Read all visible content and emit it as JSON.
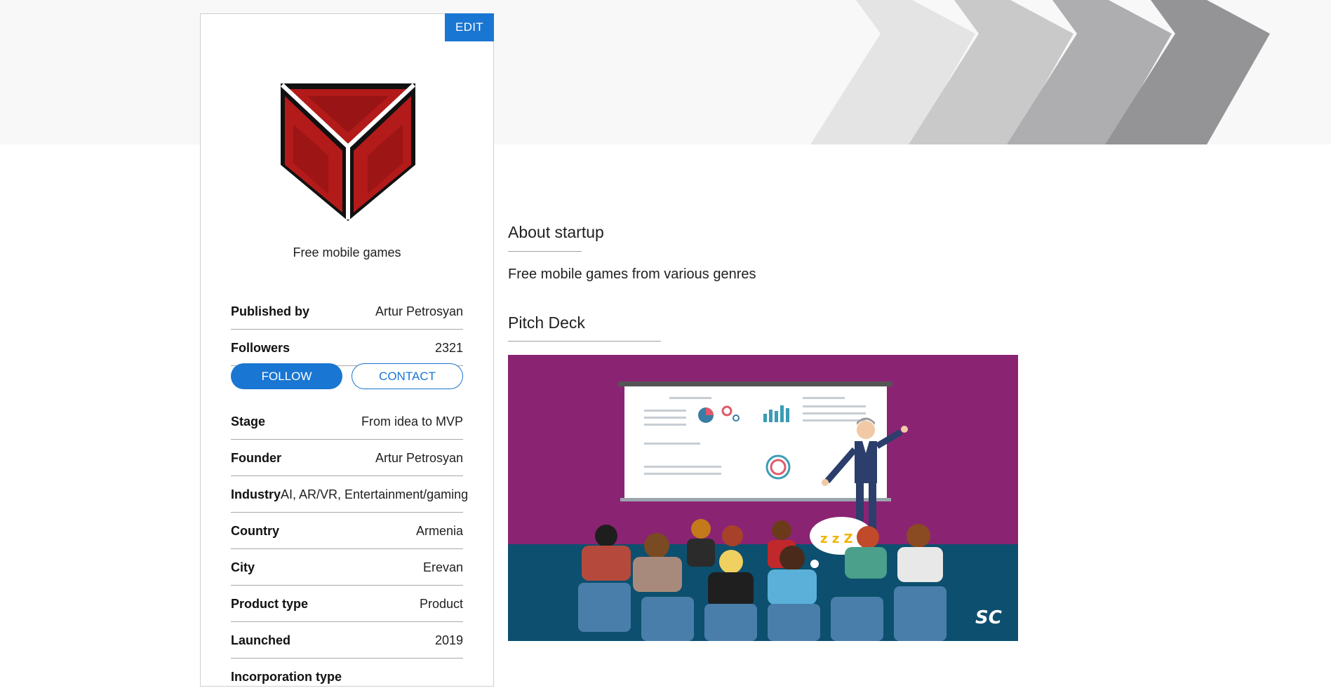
{
  "banner": {
    "chevron_colors": [
      "#e4e4e4",
      "#c9c9c9",
      "#aeaeb0",
      "#949497"
    ]
  },
  "card": {
    "edit_label": "EDIT",
    "tagline": "Free mobile games",
    "rows_top": [
      {
        "label": "Published by",
        "value": "Artur Petrosyan"
      },
      {
        "label": "Followers",
        "value": "2321"
      }
    ],
    "follow_label": "FOLLOW",
    "contact_label": "CONTACT",
    "rows_details": [
      {
        "label": "Stage",
        "value": "From idea to MVP"
      },
      {
        "label": "Founder",
        "value": "Artur Petrosyan"
      },
      {
        "label": "Industry",
        "value": "AI, AR/VR, Entertainment/gaming"
      },
      {
        "label": "Country",
        "value": "Armenia"
      },
      {
        "label": "City",
        "value": "Erevan"
      },
      {
        "label": "Product type",
        "value": "Product"
      },
      {
        "label": "Launched",
        "value": "2019"
      },
      {
        "label": "Incorporation type",
        "value": ""
      }
    ]
  },
  "about": {
    "title": "About startup",
    "text": "Free mobile games from various genres"
  },
  "pitch": {
    "title": "Pitch Deck",
    "sleep_text": "z z Z Z",
    "brand_mark": "SC"
  },
  "colors": {
    "accent": "#1976d2",
    "slide_bg": "#8b2373",
    "floor": "#0d4f6e",
    "logo_red": "#b31a1a"
  }
}
